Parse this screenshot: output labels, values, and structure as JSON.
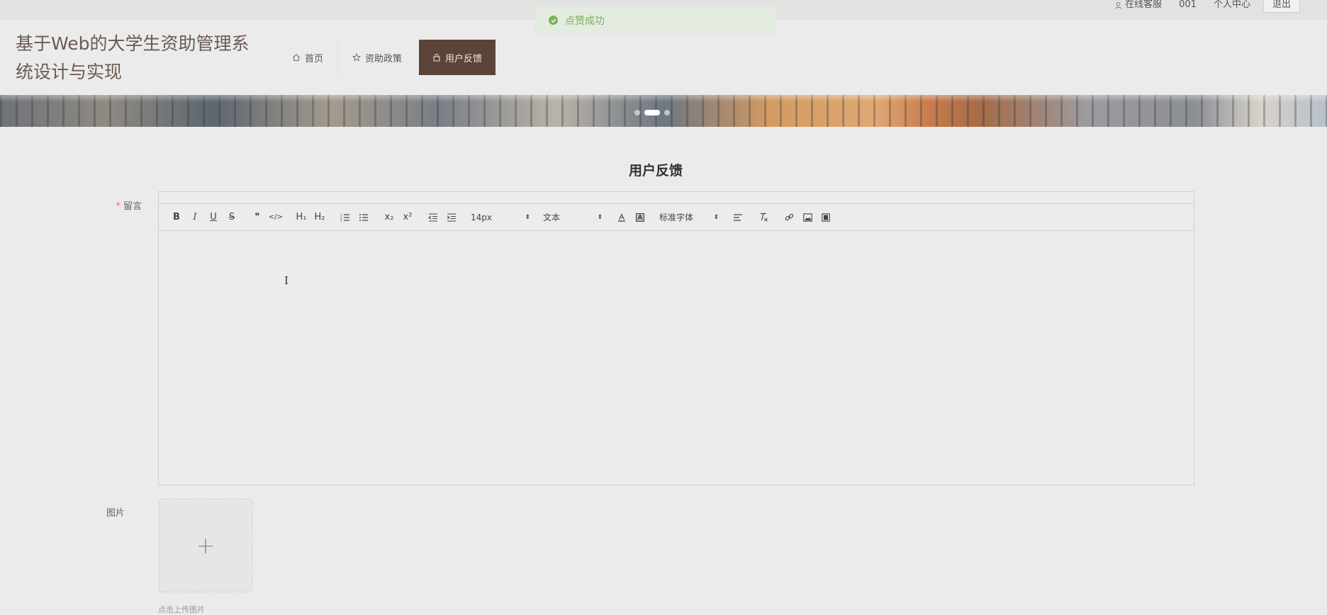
{
  "topbar": {
    "service_label": "在线客服",
    "user_id": "001",
    "profile_label": "个人中心",
    "logout_label": "退出"
  },
  "toast": {
    "message": "点赞成功",
    "color": "#79b35a"
  },
  "header": {
    "site_title": "基于Web的大学生资助管理系统设计与实现",
    "nav": [
      {
        "label": "首页",
        "icon": "home-icon"
      },
      {
        "label": "资助政策",
        "icon": "star-icon"
      },
      {
        "label": "用户反馈",
        "icon": "bag-icon",
        "active": true
      }
    ],
    "active_color": "#5b4437"
  },
  "banner": {
    "slide_count": 3,
    "active_index": 1
  },
  "main": {
    "page_title": "用户反馈",
    "message_label": "留言",
    "required_mark": "*",
    "editor": {
      "toolbar": {
        "bold": "B",
        "italic": "I",
        "underline": "U",
        "strike": "S",
        "quote": "❞",
        "code": "</>",
        "h1": "H₁",
        "h2": "H₂",
        "ordered_list": "ordered-list-icon",
        "bullet_list": "bullet-list-icon",
        "sub": "x₂",
        "sup": "x²",
        "font_size": "14px",
        "heading_select": "文本",
        "font_family": "标准字体"
      },
      "content": ""
    },
    "image_label": "图片",
    "upload_plus": "+",
    "upload_tip": "点击上传图片"
  }
}
